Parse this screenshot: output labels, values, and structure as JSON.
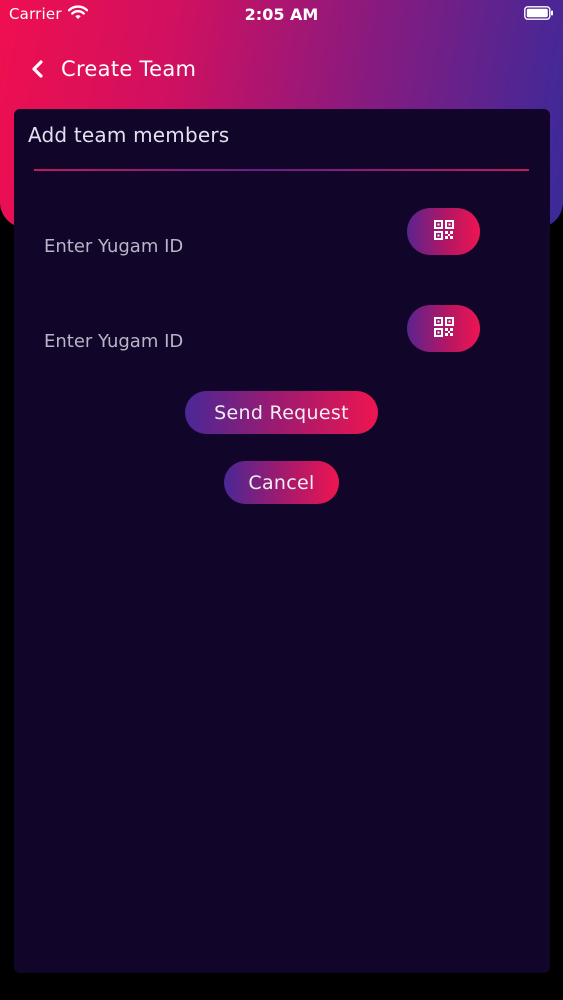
{
  "status_bar": {
    "carrier": "Carrier",
    "time": "2:05 AM"
  },
  "nav": {
    "title": "Create Team"
  },
  "card": {
    "title": "Add team members",
    "members": [
      {
        "placeholder": "Enter Yugam ID",
        "value": ""
      },
      {
        "placeholder": "Enter Yugam ID",
        "value": ""
      }
    ],
    "send_label": "Send Request",
    "cancel_label": "Cancel"
  },
  "icons": {
    "back": "chevron-left-icon",
    "scan": "qr-code-icon",
    "wifi": "wifi-icon",
    "battery": "battery-icon"
  },
  "colors": {
    "header_gradient_start": "#ef0f4f",
    "header_gradient_end": "#3a2a9a",
    "card_background": "#110629",
    "screen_background": "#000000",
    "button_gradient_start": "#4a2896",
    "button_gradient_end": "#ee1550"
  }
}
